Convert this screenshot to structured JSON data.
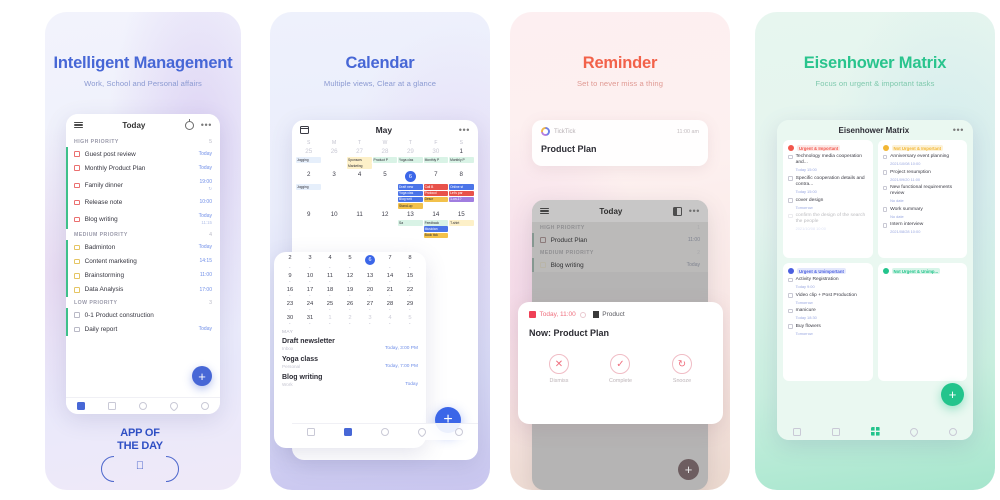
{
  "panels": [
    {
      "id": "intelligent-management",
      "title": "Intelligent Management",
      "subtitle": "Work, School and Personal affairs",
      "app": {
        "appbar": {
          "title": "Today",
          "menu_icon": "hamburger-icon",
          "focus_icon": "timer-icon",
          "more_icon": "more-dots-icon"
        },
        "sections": [
          {
            "label": "HIGH PRIORITY",
            "count": "5",
            "tasks": [
              {
                "name": "Guest post review",
                "time": "Today",
                "time2": ""
              },
              {
                "name": "Monthly Product Plan",
                "time": "Today",
                "time2": ""
              },
              {
                "name": "Family dinner",
                "time": "19:00",
                "time2": "↻"
              },
              {
                "name": "Release note",
                "time": "10:00",
                "time2": ""
              },
              {
                "name": "Blog writing",
                "time": "Today",
                "time2": "11:15"
              }
            ]
          },
          {
            "label": "MEDIUM PRIORITY",
            "count": "4",
            "tasks": [
              {
                "name": "Badminton",
                "time": "Today",
                "time2": ""
              },
              {
                "name": "Content marketing",
                "time": "14:15",
                "time2": ""
              },
              {
                "name": "Brainstorming",
                "time": "11:00",
                "time2": ""
              },
              {
                "name": "Data Analysis",
                "time": "17:00",
                "time2": ""
              }
            ]
          },
          {
            "label": "LOW PRIORITY",
            "count": "3",
            "tasks": [
              {
                "name": "0-1 Product construction",
                "time": "",
                "time2": ""
              },
              {
                "name": "Daily report",
                "time": "Today",
                "time2": ""
              }
            ]
          }
        ],
        "fab_label": "+",
        "nav": [
          "tasks-nav-icon",
          "calendar-nav-icon",
          "pomo-nav-icon",
          "habit-nav-icon",
          "settings-nav-icon"
        ]
      },
      "award": {
        "line1": "APP OF",
        "line2": "THE DAY",
        "badge_icon": "apple-logo-icon"
      }
    },
    {
      "id": "calendar",
      "title": "Calendar",
      "subtitle": "Multiple views, Clear at a glance",
      "app": {
        "header": {
          "month": "May",
          "view_icon": "calendar-view-icon",
          "more_icon": "more-dots-icon"
        },
        "dow": [
          "S",
          "M",
          "T",
          "W",
          "T",
          "F",
          "S"
        ],
        "weeks": [
          {
            "days": [
              "25",
              "26",
              "27",
              "28",
              "29",
              "30",
              "1"
            ],
            "muted": [
              true,
              true,
              true,
              true,
              true,
              true,
              false
            ],
            "selected": -1,
            "chips": [
              [
                {
                  "t": "Jogging",
                  "c": "#e6effb"
                }
              ],
              [],
              [
                {
                  "t": "Sponsors",
                  "c": "#fdf0c8"
                },
                {
                  "t": "Marketing",
                  "c": "#fdf0c8"
                }
              ],
              [
                {
                  "t": "Product P",
                  "c": "#d9f3e6"
                }
              ],
              [
                {
                  "t": "Yoga clas",
                  "c": "#d9f3e6"
                }
              ],
              [
                {
                  "t": "Monthly P",
                  "c": "#d9f3e6"
                }
              ],
              [
                {
                  "t": "Monthly P",
                  "c": "#d9f3e6"
                }
              ]
            ]
          },
          {
            "days": [
              "2",
              "3",
              "4",
              "5",
              "6",
              "7",
              "8"
            ],
            "muted": [
              false,
              false,
              false,
              false,
              false,
              false,
              false
            ],
            "selected": 4,
            "chips": [
              [
                {
                  "t": "Jogging",
                  "c": "#e6effb"
                }
              ],
              [],
              [],
              [],
              [
                {
                  "t": "Draft new",
                  "c": "#4b74e8",
                  "fg": "#fff"
                },
                {
                  "t": "Yoga clas",
                  "c": "#4b74e8",
                  "fg": "#fff"
                },
                {
                  "t": "Blog writ",
                  "c": "#4b74e8",
                  "fg": "#fff"
                },
                {
                  "t": "Stand-up",
                  "c": "#f2c14b"
                }
              ],
              [
                {
                  "t": "Call B",
                  "c": "#e8524a",
                  "fg": "#fff"
                },
                {
                  "t": "Protocol",
                  "c": "#e8524a",
                  "fg": "#fff"
                },
                {
                  "t": "Descr",
                  "c": "#f2c14b"
                }
              ],
              [
                {
                  "t": "Online st",
                  "c": "#4b74e8",
                  "fg": "#fff"
                },
                {
                  "t": "Let's par",
                  "c": "#e8524a",
                  "fg": "#fff"
                },
                {
                  "t": "1-on-1?",
                  "c": "#a07de0",
                  "fg": "#fff"
                }
              ]
            ]
          },
          {
            "days": [
              "9",
              "10",
              "11",
              "12",
              "13",
              "14",
              "15"
            ],
            "muted": [
              false,
              false,
              false,
              false,
              false,
              false,
              false
            ],
            "selected": -1,
            "chips": [
              [],
              [],
              [],
              [],
              [
                {
                  "t": "Sa",
                  "c": "#d9f3e6"
                }
              ],
              [
                {
                  "t": "Feedback",
                  "c": "#d9f3e6"
                },
                {
                  "t": "Musician",
                  "c": "#4b74e8",
                  "fg": "#fff"
                },
                {
                  "t": "Book tick",
                  "c": "#f2c14b"
                }
              ],
              [
                {
                  "t": "T-shirt",
                  "c": "#fdf0c8"
                }
              ]
            ]
          }
        ],
        "mini": {
          "weeks": [
            {
              "days": [
                "2",
                "3",
                "4",
                "5",
                "6",
                "7",
                "8"
              ],
              "selected": 4
            },
            {
              "days": [
                "9",
                "10",
                "11",
                "12",
                "13",
                "14",
                "15"
              ],
              "selected": -1
            },
            {
              "days": [
                "16",
                "17",
                "18",
                "19",
                "20",
                "21",
                "22"
              ],
              "selected": -1
            },
            {
              "days": [
                "23",
                "24",
                "25",
                "26",
                "27",
                "28",
                "29"
              ],
              "selected": -1
            },
            {
              "days": [
                "30",
                "31",
                "1",
                "2",
                "3",
                "4",
                "5"
              ],
              "selected": -1
            }
          ]
        },
        "agenda_header": "MAY",
        "agenda": [
          {
            "title": "Draft newsletter",
            "list": "Inbox",
            "time": "Today, 3:00 PM"
          },
          {
            "title": "Yoga class",
            "list": "Personal",
            "time": "Today, 7:00 PM"
          },
          {
            "title": "Blog writing",
            "list": "Work",
            "time": "Today"
          }
        ],
        "fab_label": "+",
        "nav": [
          "tasks-nav-icon",
          "calendar-nav-icon",
          "pomo-nav-icon",
          "habit-nav-icon",
          "settings-nav-icon"
        ]
      }
    },
    {
      "id": "reminder",
      "title": "Reminder",
      "subtitle": "Set to never miss a thing",
      "notification": {
        "app": "TickTick",
        "time": "11:00 am",
        "body": "Product Plan",
        "icon": "ticktick-logo-icon"
      },
      "app": {
        "appbar": {
          "title": "Today",
          "menu_icon": "hamburger-icon",
          "view_icon": "column-view-icon",
          "more_icon": "more-dots-icon"
        },
        "sections": [
          {
            "label": "HIGH PRIORITY",
            "count": "1",
            "tasks": [
              {
                "name": "Product Plan",
                "time": "11:00",
                "time2": ""
              }
            ]
          },
          {
            "label": "MEDIUM PRIORITY",
            "count": "2",
            "tasks": [
              {
                "name": "Blog writing",
                "time": "Today",
                "time2": ""
              }
            ]
          }
        ],
        "fab_label": "+"
      },
      "dialog": {
        "flag_icon": "flag-icon",
        "when": "Today, 11:00",
        "repeat_icon": "repeat-icon",
        "list_icon": "list-color-icon",
        "list": "Product",
        "title": "Now: Product Plan",
        "actions": [
          {
            "label": "Dismiss",
            "icon": "close-circle-icon",
            "glyph": "✕"
          },
          {
            "label": "Complete",
            "icon": "check-circle-icon",
            "glyph": "✓"
          },
          {
            "label": "Snooze",
            "icon": "snooze-circle-icon",
            "glyph": "↻"
          }
        ]
      }
    },
    {
      "id": "eisenhower-matrix",
      "title": "Eisenhower Matrix",
      "subtitle": "Focus on urgent & important tasks",
      "app": {
        "header": {
          "title": "Eisenhower Matrix",
          "more_icon": "more-dots-icon"
        },
        "quadrants": [
          {
            "label": "Urgent & Important",
            "color": "#f2564c",
            "bg": "#fde8e6",
            "items": [
              {
                "name": "Technology media cooperation and...",
                "date": "Today 15:00",
                "faded": false
              },
              {
                "name": "Specific cooperation details and contra...",
                "date": "Today 15:00",
                "faded": false
              },
              {
                "name": "cover design",
                "date": "Tomorrow",
                "faded": false
              },
              {
                "name": "confirm the design of the search the people",
                "date": "2021/10/08 10:00",
                "faded": true
              }
            ]
          },
          {
            "label": "Not Urgent & Important",
            "color": "#f2b634",
            "bg": "#fdf2d8",
            "items": [
              {
                "name": "Anniversary event planning",
                "date": "2021/10/08 10:00",
                "faded": false
              },
              {
                "name": "Project resumption",
                "date": "2021/09/20 11:00",
                "faded": false
              },
              {
                "name": "New functional requirements review",
                "date": "No date",
                "faded": false
              },
              {
                "name": "Work summary",
                "date": "No date",
                "faded": false
              },
              {
                "name": "Intern interview",
                "date": "2021/08/28 10:00",
                "faded": false
              }
            ]
          },
          {
            "label": "Urgent & Unimportant",
            "color": "#4b5fe0",
            "bg": "#e4e8fc",
            "items": [
              {
                "name": "Activity Registration",
                "date": "Today 9:00",
                "faded": false
              },
              {
                "name": "Video clip + Post Production",
                "date": "Tomorrow",
                "faded": false
              },
              {
                "name": "manicure",
                "date": "Today 18:30",
                "faded": false
              },
              {
                "name": "Buy flowers",
                "date": "Tomorrow",
                "faded": false
              }
            ]
          },
          {
            "label": "Not Urgent & Unimp...",
            "color": "#23c48c",
            "bg": "#d8f5e9",
            "items": []
          }
        ],
        "fab_label": "+",
        "nav": [
          "tasks-nav-icon",
          "calendar-nav-icon",
          "matrix-nav-icon",
          "habit-nav-icon",
          "settings-nav-icon"
        ]
      }
    }
  ]
}
